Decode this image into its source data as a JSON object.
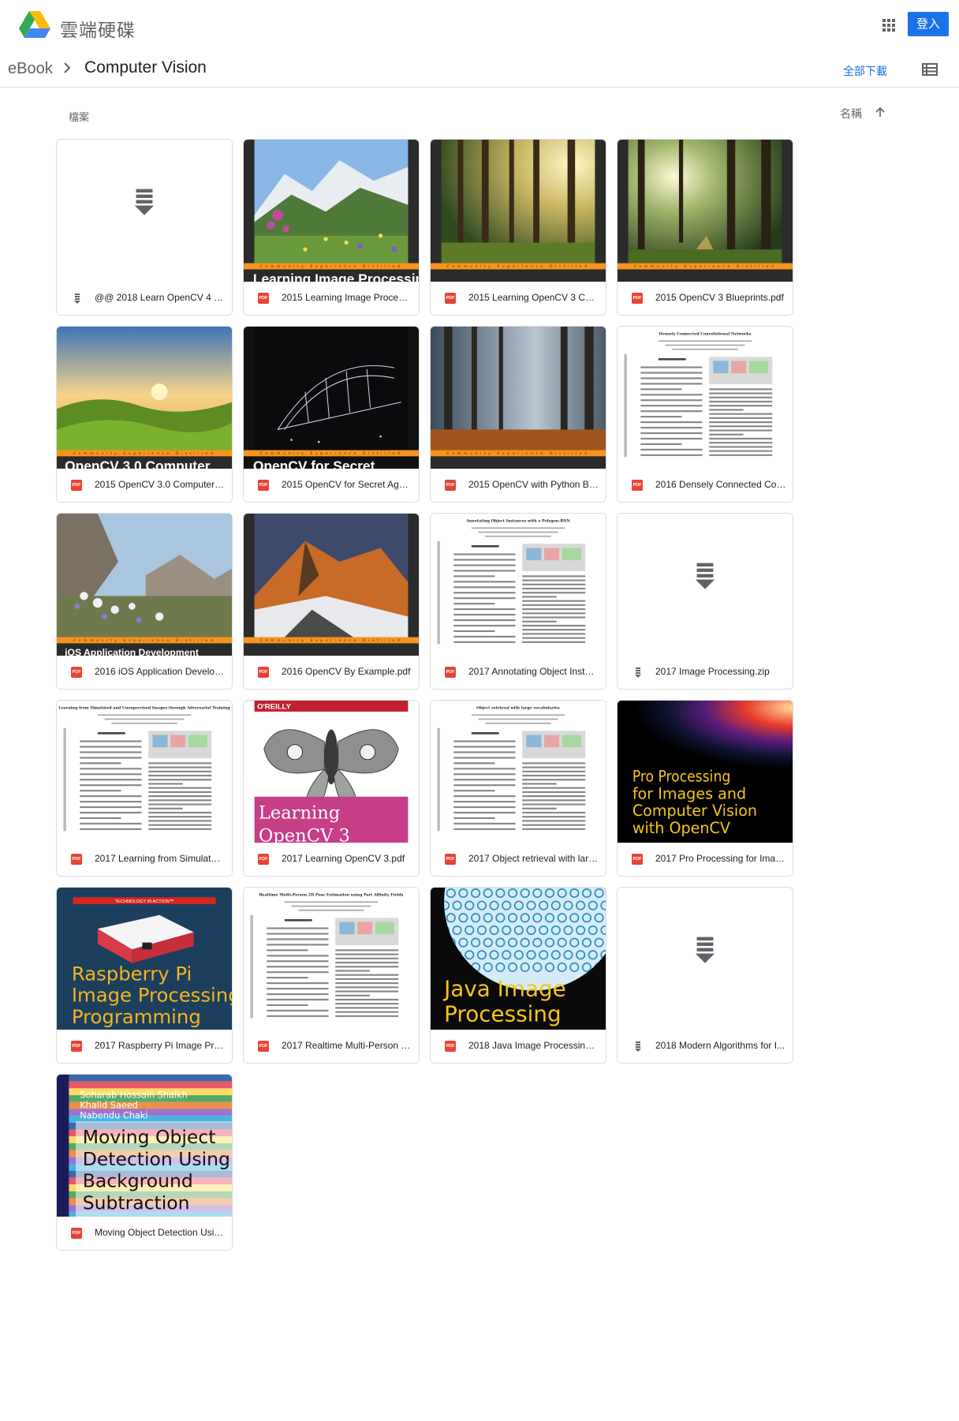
{
  "app": {
    "brand": "雲端硬碟",
    "signin_label": "登入",
    "apps_icon": "apps-grid-icon"
  },
  "breadcrumb": {
    "root": "eBook",
    "current": "Computer Vision",
    "download_all": "全部下載",
    "view_icon": "list-view-icon"
  },
  "section": {
    "label": "檔案",
    "sort_label": "名稱",
    "sort_direction_icon": "arrow-up-icon"
  },
  "files": [
    {
      "name": "@@ 2018 Learn OpenCV 4 by ...",
      "type": "zip",
      "cover": "blank"
    },
    {
      "name": "2015 Learning Image Processi...",
      "type": "pdf",
      "cover": "mountain-flowers"
    },
    {
      "name": "2015 Learning OpenCV 3 Com...",
      "type": "pdf",
      "cover": "forest-sun"
    },
    {
      "name": "2015 OpenCV 3 Blueprints.pdf",
      "type": "pdf",
      "cover": "forest-light"
    },
    {
      "name": "2015 OpenCV 3.0 Computer Vi...",
      "type": "pdf",
      "cover": "green-hills"
    },
    {
      "name": "2015 OpenCV for Secret Agent...",
      "type": "pdf",
      "cover": "bridge-night"
    },
    {
      "name": "2015 OpenCV with Python Blu...",
      "type": "pdf",
      "cover": "misty-forest"
    },
    {
      "name": "2016 Densely Connected Conv...",
      "type": "pdf",
      "cover": "paper"
    },
    {
      "name": "2016 iOS Application Develop...",
      "type": "pdf",
      "cover": "alpine-flowers"
    },
    {
      "name": "2016 OpenCV By Example.pdf",
      "type": "pdf",
      "cover": "sunset-peak"
    },
    {
      "name": "2017 Annotating Object Instan...",
      "type": "pdf",
      "cover": "paper"
    },
    {
      "name": "2017 Image Processing.zip",
      "type": "zip",
      "cover": "blank"
    },
    {
      "name": "2017 Learning from Simulated...",
      "type": "pdf",
      "cover": "paper"
    },
    {
      "name": "2017 Learning OpenCV 3.pdf",
      "type": "pdf",
      "cover": "oreilly-moth"
    },
    {
      "name": "2017 Object retrieval with larg...",
      "type": "pdf",
      "cover": "paper"
    },
    {
      "name": "2017 Pro Processing for Imag...",
      "type": "pdf",
      "cover": "pro-processing"
    },
    {
      "name": "2017 Raspberry Pi Image Proc...",
      "type": "pdf",
      "cover": "raspberry"
    },
    {
      "name": "2017 Realtime Multi-Person 2...",
      "type": "pdf",
      "cover": "paper"
    },
    {
      "name": "2018 Java Image Processing ...",
      "type": "pdf",
      "cover": "java"
    },
    {
      "name": "2018 Modern Algorithms for I...",
      "type": "zip",
      "cover": "blank"
    },
    {
      "name": "Moving Object Detection Usin...",
      "type": "pdf",
      "cover": "moving-object"
    }
  ],
  "covers": {
    "mountain_band": "Community Experience Distilled",
    "cover_titles": {
      "green-hills": "OpenCV 3.0 Computer",
      "bridge-night": "OpenCV for Secret",
      "alpine-flowers": "iOS Application Development",
      "mountain-flowers": "Learning Image Processing"
    },
    "oreilly": {
      "publisher": "O'REILLY",
      "title": "Learning OpenCV 3"
    },
    "pro": {
      "l1": "Pro Processing",
      "l2": "for Images and",
      "l3": "Computer Vision",
      "l4": "with OpenCV"
    },
    "raspberry": {
      "series": "TECHNOLOGY IN ACTION™",
      "l1": "Raspberry Pi",
      "l2": "Image Processing",
      "l3": "Programming"
    },
    "java": {
      "l1": "Java Image",
      "l2": "Processing"
    },
    "moving": {
      "authors": [
        "Soharab Hossain Shaikh",
        "Khalid Saeed",
        "Nabendu Chaki"
      ],
      "l1": "Moving Object",
      "l2": "Detection Using",
      "l3": "Background",
      "l4": "Subtraction"
    },
    "paper_titles": {
      "7": "Densely Connected Convolutional Networks",
      "10": "Annotating Object Instances with a Polygon-RNN",
      "12": "Learning from Simulated and Unsupervised Images through Adversarial Training",
      "14": "Object retrieval with large vocabularies",
      "17": "Realtime Multi-Person 2D Pose Estimation using Part Affinity Fields"
    }
  },
  "colors": {
    "accent": "#1a73e8",
    "pdf_red": "#e94235",
    "packt_orange": "#f7941d",
    "border": "#dadce0"
  }
}
